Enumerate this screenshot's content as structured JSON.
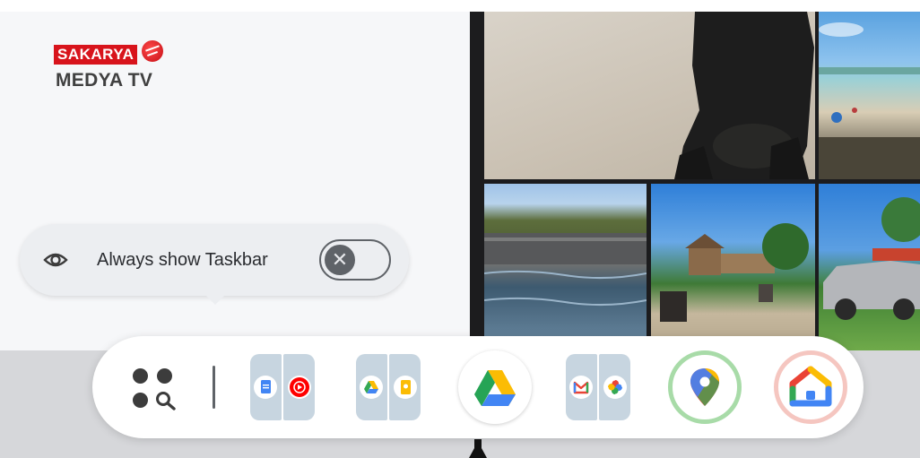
{
  "logo": {
    "line1": "SAKARYA",
    "line2": "MEDYA TV"
  },
  "tooltip": {
    "label": "Always show Taskbar",
    "toggle": {
      "state": "off",
      "knob_glyph": "✕"
    }
  },
  "taskbar": {
    "apps": [
      {
        "name": "apps-launcher"
      },
      {
        "name": "docs-youtube-music-pair"
      },
      {
        "name": "drive-keep-pair"
      },
      {
        "name": "google-drive"
      },
      {
        "name": "gmail-photos-pair"
      },
      {
        "name": "google-maps"
      },
      {
        "name": "google-home"
      }
    ]
  },
  "colors": {
    "page_bg": "#d6d7da",
    "pane_bg": "#f6f7f9",
    "tooltip_bg": "#eceef1",
    "taskbar_bg": "#ffffff",
    "pair_tile": "#c7d5e0",
    "maps_ring": "#a8dba8",
    "home_ring": "#f5c6c0"
  }
}
